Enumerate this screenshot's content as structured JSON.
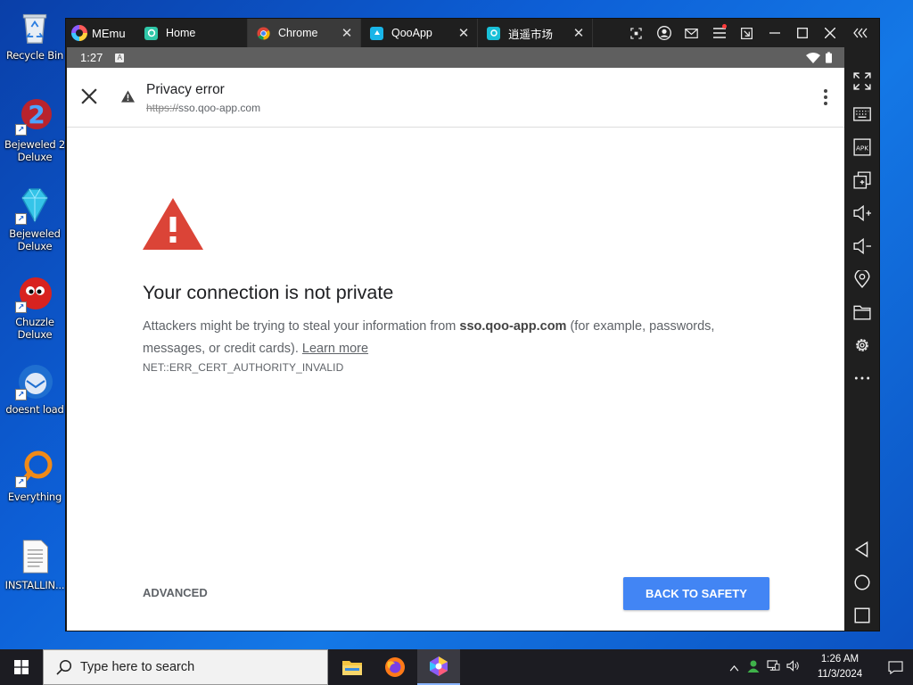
{
  "desktop": {
    "icons": [
      {
        "label": "Recycle Bin",
        "icon": "recycle-bin-icon"
      },
      {
        "label": "Bejeweled 2 Deluxe",
        "icon": "bejeweled2-icon"
      },
      {
        "label": "Bejeweled Deluxe",
        "icon": "bejeweled-icon"
      },
      {
        "label": "Chuzzle Deluxe",
        "icon": "chuzzle-icon"
      },
      {
        "label": "doesnt load",
        "icon": "thunderbird-icon"
      },
      {
        "label": "Everything",
        "icon": "everything-search-icon"
      },
      {
        "label": "INSTALLIN...",
        "icon": "text-file-icon"
      }
    ]
  },
  "memu": {
    "brand": "MEmu",
    "tabs": [
      {
        "label": "Home",
        "icon": "home-tab-icon",
        "color": "#2fc7a8"
      },
      {
        "label": "Chrome",
        "icon": "chrome-icon",
        "active": true
      },
      {
        "label": "QooApp",
        "icon": "qooapp-icon",
        "color": "#19b5e8"
      },
      {
        "label": "逍遥市场",
        "icon": "market-icon",
        "color": "#19c0d8"
      }
    ],
    "window_controls": [
      "screenshot-icon",
      "account-icon",
      "mail-icon",
      "menu-icon",
      "sync-icon",
      "minimize-icon",
      "maximize-icon",
      "close-icon",
      "collapse-sidebar-icon"
    ],
    "sidebar_tools": [
      "fullscreen-icon",
      "keyboard-icon",
      "apk-icon",
      "multi-instance-icon",
      "volume-up-icon",
      "volume-down-icon",
      "location-icon",
      "folder-icon",
      "settings-icon",
      "more-icon"
    ],
    "nav_buttons": [
      "back-icon",
      "home-icon",
      "recents-icon"
    ]
  },
  "android_status": {
    "time": "1:27",
    "badge": "A"
  },
  "chrome": {
    "page_title": "Privacy error",
    "url_scheme": "https://",
    "url_host": "sso.qoo-app.com"
  },
  "error_page": {
    "heading": "Your connection is not private",
    "body_prefix": "Attackers might be trying to steal your information from ",
    "body_host": "sso.qoo-app.com",
    "body_suffix": " (for example, passwords, messages, or credit cards). ",
    "learn_more": "Learn more",
    "error_code": "NET::ERR_CERT_AUTHORITY_INVALID",
    "advanced_label": "ADVANCED",
    "safety_label": "BACK TO SAFETY",
    "accent_color": "#4285f4",
    "warning_color": "#db4437"
  },
  "taskbar": {
    "search_placeholder": "Type here to search",
    "apps": [
      "file-explorer-icon",
      "firefox-icon",
      "memu-icon"
    ],
    "time": "1:26 AM",
    "date": "11/3/2024"
  }
}
